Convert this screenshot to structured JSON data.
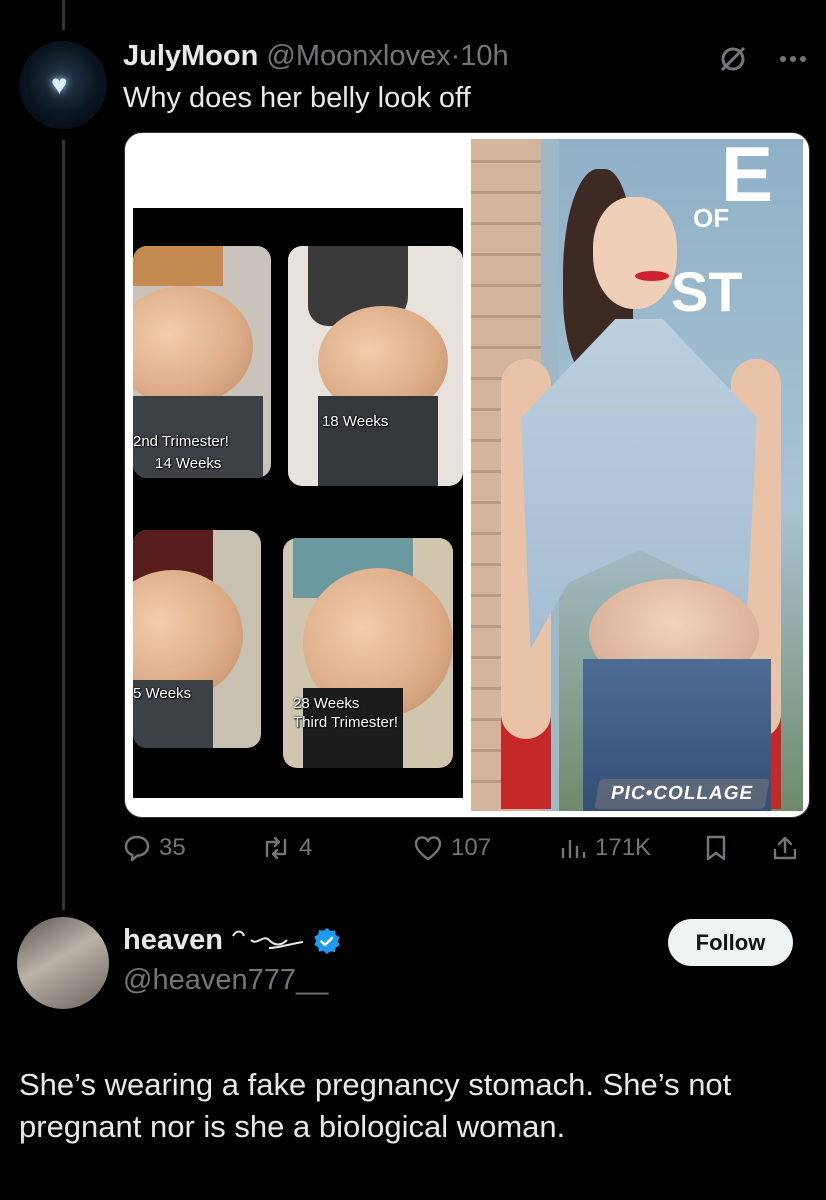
{
  "tweet1": {
    "display_name": "JulyMoon",
    "handle": "@Moonxlovex",
    "separator": "·",
    "time": "10h",
    "text": "Why does her belly look off",
    "media": {
      "captions": {
        "photo1": [
          "2nd Trimester!",
          "14 Weeks"
        ],
        "photo2": [
          "18 Weeks"
        ],
        "photo3": [
          "5 Weeks"
        ],
        "photo4": [
          "28 Weeks",
          "Third Trimester!"
        ]
      },
      "poster_text": [
        "E",
        "OF",
        "ST"
      ],
      "watermark": "PIC•COLLAGE"
    },
    "actions": {
      "replies": "35",
      "reposts": "4",
      "likes": "107",
      "views": "171K"
    },
    "icons": [
      "grok-slash-icon",
      "more-icon",
      "reply-icon",
      "repost-icon",
      "like-icon",
      "views-icon",
      "bookmark-icon",
      "share-icon"
    ]
  },
  "tweet2": {
    "display_name": "heaven",
    "handle": "@heaven777__",
    "verified": true,
    "follow_label": "Follow",
    "text": "She’s wearing a fake pregnancy stomach. She’s not pregnant nor is she a biological woman."
  },
  "colors": {
    "background": "#000000",
    "text": "#e7e9ea",
    "muted": "#71767b",
    "verified": "#1d9bf0",
    "follow_bg": "#eff3f4"
  }
}
